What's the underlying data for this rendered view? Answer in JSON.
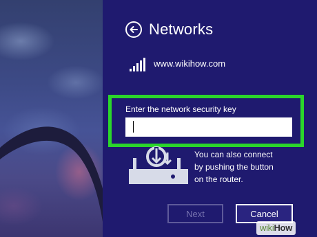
{
  "panel": {
    "title": "Networks",
    "back_icon": "back-arrow-icon"
  },
  "network": {
    "ssid": "www.wikihow.com",
    "signal_icon": "wifi-signal-icon",
    "signal_bars": 5
  },
  "security": {
    "label": "Enter the network security key",
    "value": "",
    "placeholder": ""
  },
  "wps": {
    "icon": "router-wps-icon",
    "line1": "You can also connect",
    "line2": "by pushing the button",
    "line3": "on the router."
  },
  "buttons": {
    "next": "Next",
    "cancel": "Cancel"
  },
  "colors": {
    "panel_bg": "#1f1a6f",
    "highlight": "#2bd62b",
    "text": "#ffffff",
    "disabled_text": "#7874b0"
  },
  "watermark": {
    "part1": "wiki",
    "part2": "How"
  }
}
